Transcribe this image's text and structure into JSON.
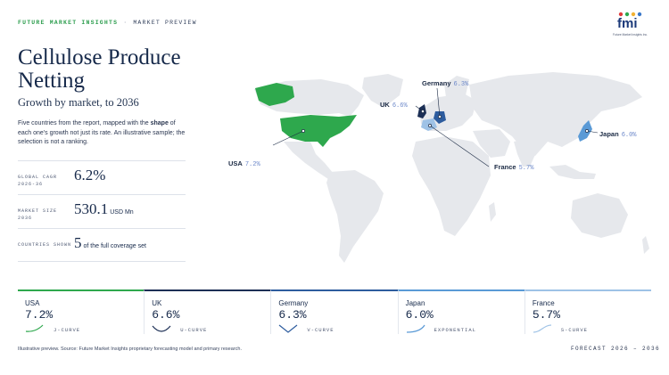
{
  "header": {
    "brand": "FUTURE MARKET INSIGHTS",
    "separator": "·",
    "section": "MARKET PREVIEW",
    "logo_text": "fmi",
    "logo_subtext": "Future Market Insights Inc."
  },
  "title": "Cellulose Produce Netting",
  "subtitle": "Growth by market, to 2036",
  "description": {
    "before": "Five countries from the report, mapped with the ",
    "bold": "shape",
    "after": " of each one's growth not just its rate. An illustrative sample; the selection is not a ranking."
  },
  "stats": [
    {
      "label": "GLOBAL CAGR 2026-36",
      "value": "6.2%",
      "unit": ""
    },
    {
      "label": "MARKET SIZE 2036",
      "value": "530.1",
      "unit": "USD Mn"
    },
    {
      "label": "COUNTRIES SHOWN",
      "value": "5",
      "unit": "of the full coverage set"
    }
  ],
  "map": {
    "labels": [
      {
        "country": "Germany",
        "rate": "6.3%"
      },
      {
        "country": "UK",
        "rate": "6.6%"
      },
      {
        "country": "Japan",
        "rate": "6.0%"
      },
      {
        "country": "France",
        "rate": "5.7%"
      },
      {
        "country": "USA",
        "rate": "7.2%"
      }
    ],
    "colors": {
      "land": "#e6e8ec",
      "usa": "#2ea84d",
      "uk": "#1c2f55",
      "germany": "#2d5c9e",
      "japan": "#5a9ad6",
      "france": "#9ec2e6"
    }
  },
  "cards": [
    {
      "country": "USA",
      "rate": "7.2%",
      "shape": "J-CURVE",
      "accent": "#2ea84d"
    },
    {
      "country": "UK",
      "rate": "6.6%",
      "shape": "U-CURVE",
      "accent": "#1c2f55"
    },
    {
      "country": "Germany",
      "rate": "6.3%",
      "shape": "V-CURVE",
      "accent": "#2d5c9e"
    },
    {
      "country": "Japan",
      "rate": "6.0%",
      "shape": "EXPONENTIAL",
      "accent": "#5a9ad6"
    },
    {
      "country": "France",
      "rate": "5.7%",
      "shape": "S-CURVE",
      "accent": "#9ec2e6"
    }
  ],
  "footer": {
    "note": "Illustrative preview. Source: Future Market Insights proprietary forecasting model and primary research.",
    "forecast": "FORECAST 2026 – 2036"
  }
}
